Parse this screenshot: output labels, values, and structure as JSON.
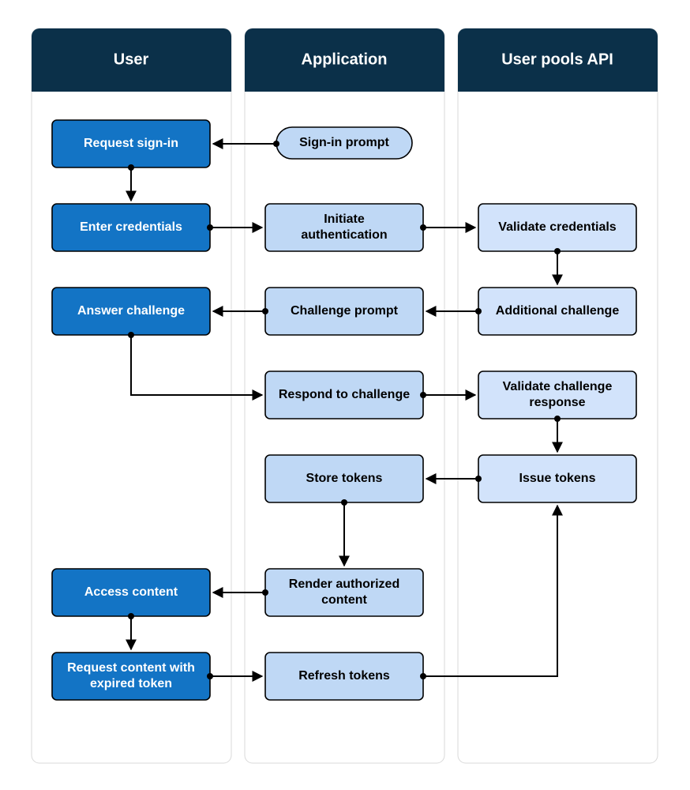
{
  "lanes": {
    "user": {
      "title": "User"
    },
    "app": {
      "title": "Application"
    },
    "api": {
      "title": "User pools API"
    }
  },
  "nodes": {
    "signin_prompt": "Sign-in prompt",
    "request_signin": "Request sign-in",
    "enter_credentials": "Enter credentials",
    "initiate_auth_l1": "Initiate",
    "initiate_auth_l2": "authentication",
    "validate_creds": "Validate credentials",
    "additional_challenge": "Additional challenge",
    "challenge_prompt": "Challenge prompt",
    "answer_challenge": "Answer challenge",
    "respond_challenge": "Respond to challenge",
    "validate_resp_l1": "Validate challenge",
    "validate_resp_l2": "response",
    "issue_tokens": "Issue tokens",
    "store_tokens": "Store tokens",
    "render_auth_l1": "Render authorized",
    "render_auth_l2": "content",
    "access_content": "Access content",
    "req_expired_l1": "Request content with",
    "req_expired_l2": "expired token",
    "refresh_tokens": "Refresh tokens"
  }
}
